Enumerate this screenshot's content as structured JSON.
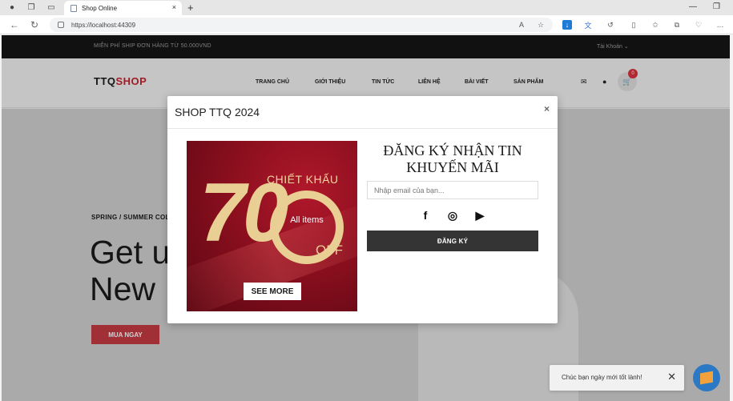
{
  "browser": {
    "tab_title": "Shop Online",
    "url": "https://localhost:44309",
    "new_tab_symbol": "+",
    "tab_close_symbol": "×"
  },
  "site": {
    "shipping_notice": "MIỄN PHÍ SHIP ĐƠN HÀNG TỪ 50.000VND",
    "account_label": "Tài Khoản",
    "logo_part1": "TTQ",
    "logo_part2": "SHOP",
    "menu": [
      "TRANG CHỦ",
      "GIỚI THIỆU",
      "TIN TỨC",
      "LIÊN HỆ",
      "BÀI VIẾT",
      "SẢN PHẨM"
    ],
    "cart_count": "0",
    "hero": {
      "collection": "SPRING / SUMMER COL",
      "headline_line1": "Get u",
      "headline_line2": "New",
      "cta": "MUA NGAY"
    }
  },
  "modal": {
    "title": "SHOP TTQ 2024",
    "close_symbol": "×",
    "promo": {
      "heading": "CHIẾT KHẤU",
      "number": "70",
      "all_items": "All items",
      "off": "OFF",
      "see_more": "SEE MORE"
    },
    "form_title_line1": "ĐĂNG KÝ NHẬN TIN",
    "form_title_line2": "KHUYẾN MÃI",
    "email_placeholder": "Nhập email của bạn...",
    "signup_label": "ĐĂNG KÝ",
    "socials": [
      {
        "icon": "facebook-icon",
        "glyph": "f"
      },
      {
        "icon": "instagram-icon",
        "glyph": "◎"
      },
      {
        "icon": "youtube-icon",
        "glyph": "▶"
      }
    ]
  },
  "toast": {
    "message": "Chúc bạn ngày mới tốt lành!",
    "close_symbol": "✕"
  },
  "colors": {
    "brand_red": "#c9202b",
    "dark_button": "#343434",
    "topbar": "#151515"
  }
}
